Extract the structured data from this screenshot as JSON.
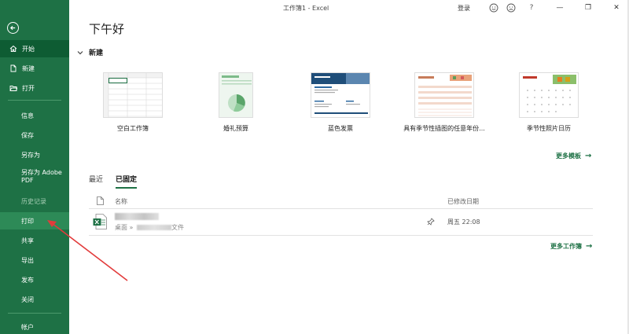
{
  "titlebar": {
    "title": "工作簿1 - Excel",
    "login": "登录",
    "help": "?",
    "minimize": "—",
    "restore": "❐",
    "close": "✕"
  },
  "sidebar": {
    "back_icon": "arrow-left-circle",
    "items": [
      {
        "label": "开始",
        "icon": "home-icon"
      },
      {
        "label": "新建",
        "icon": "new-doc-icon"
      },
      {
        "label": "打开",
        "icon": "folder-open-icon"
      },
      {
        "label": "信息"
      },
      {
        "label": "保存"
      },
      {
        "label": "另存为"
      },
      {
        "label": "另存为 Adobe PDF"
      },
      {
        "label": "历史记录"
      },
      {
        "label": "打印"
      },
      {
        "label": "共享"
      },
      {
        "label": "导出"
      },
      {
        "label": "发布"
      },
      {
        "label": "关闭"
      },
      {
        "label": "帐户"
      }
    ]
  },
  "main": {
    "greeting": "下午好",
    "new_section": "新建",
    "templates": [
      {
        "label": "空白工作簿"
      },
      {
        "label": "婚礼预算"
      },
      {
        "label": "蓝色发票"
      },
      {
        "label": "具有季节性插图的任意年份..."
      },
      {
        "label": "季节性照片日历"
      }
    ],
    "more_templates": "更多模板",
    "tabs": [
      {
        "label": "最近",
        "active": false
      },
      {
        "label": "已固定",
        "active": true
      }
    ],
    "list": {
      "col_name": "名称",
      "col_date": "已修改日期",
      "rows": [
        {
          "path_prefix": "桌面 » ",
          "path_suffix": "文件",
          "date": "周五 22:08",
          "icon": "excel-file-icon"
        }
      ]
    },
    "more_workbooks": "更多工作簿"
  },
  "colors": {
    "sidebar_bg": "#1e7145",
    "sidebar_active": "#0e5c33",
    "accent": "#1e7145"
  }
}
